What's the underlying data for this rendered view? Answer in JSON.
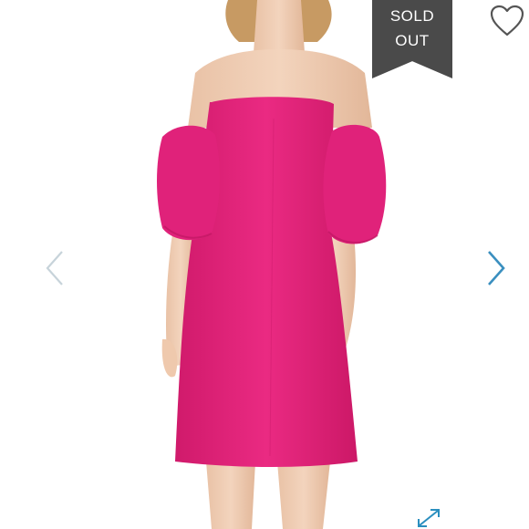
{
  "listing": {
    "badge_line1": "SOLD",
    "badge_line2": "OUT",
    "badge_color": "#4a4a4a",
    "dress_color": "#e8247c"
  },
  "icons": {
    "like": "heart-icon",
    "previous": "chevron-left-icon",
    "next": "chevron-right-icon",
    "zoom": "expand-icon"
  },
  "colors": {
    "arrow_active": "#3a8fbf",
    "arrow_inactive": "#c7d3da"
  }
}
